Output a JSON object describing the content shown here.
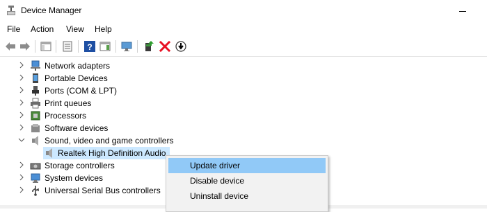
{
  "window": {
    "title": "Device Manager"
  },
  "menu": [
    "File",
    "Action",
    "View",
    "Help"
  ],
  "toolbar": {
    "buttons": [
      "back-icon",
      "forward-icon",
      "show-hide-console-tree-icon",
      "properties-icon",
      "help-icon",
      "action-pane-icon",
      "scan-hardware-icon",
      "update-driver-icon",
      "uninstall-icon",
      "disable-device-icon"
    ]
  },
  "tree": {
    "items": [
      {
        "label": "Network adapters",
        "icon": "network-adapter-icon",
        "expanded": false
      },
      {
        "label": "Portable Devices",
        "icon": "portable-device-icon",
        "expanded": false
      },
      {
        "label": "Ports (COM & LPT)",
        "icon": "port-icon",
        "expanded": false
      },
      {
        "label": "Print queues",
        "icon": "printer-icon",
        "expanded": false
      },
      {
        "label": "Processors",
        "icon": "processor-icon",
        "expanded": false
      },
      {
        "label": "Software devices",
        "icon": "software-device-icon",
        "expanded": false
      },
      {
        "label": "Sound, video and game controllers",
        "icon": "speaker-icon",
        "expanded": true
      },
      {
        "label": "Realtek High Definition Audio",
        "icon": "audio-device-icon",
        "child": true,
        "selected": true
      },
      {
        "label": "Storage controllers",
        "icon": "storage-icon",
        "expanded": false
      },
      {
        "label": "System devices",
        "icon": "system-device-icon",
        "expanded": false
      },
      {
        "label": "Universal Serial Bus controllers",
        "icon": "usb-icon",
        "expanded": false
      }
    ]
  },
  "context_menu": {
    "items": [
      {
        "label": "Update driver",
        "highlighted": true
      },
      {
        "label": "Disable device",
        "highlighted": false
      },
      {
        "label": "Uninstall device",
        "highlighted": false
      }
    ]
  },
  "colors": {
    "selection": "#cce8ff",
    "menu_highlight": "#91c9f7",
    "uninstall_red": "#e81123",
    "help_blue": "#1e4fa3"
  }
}
